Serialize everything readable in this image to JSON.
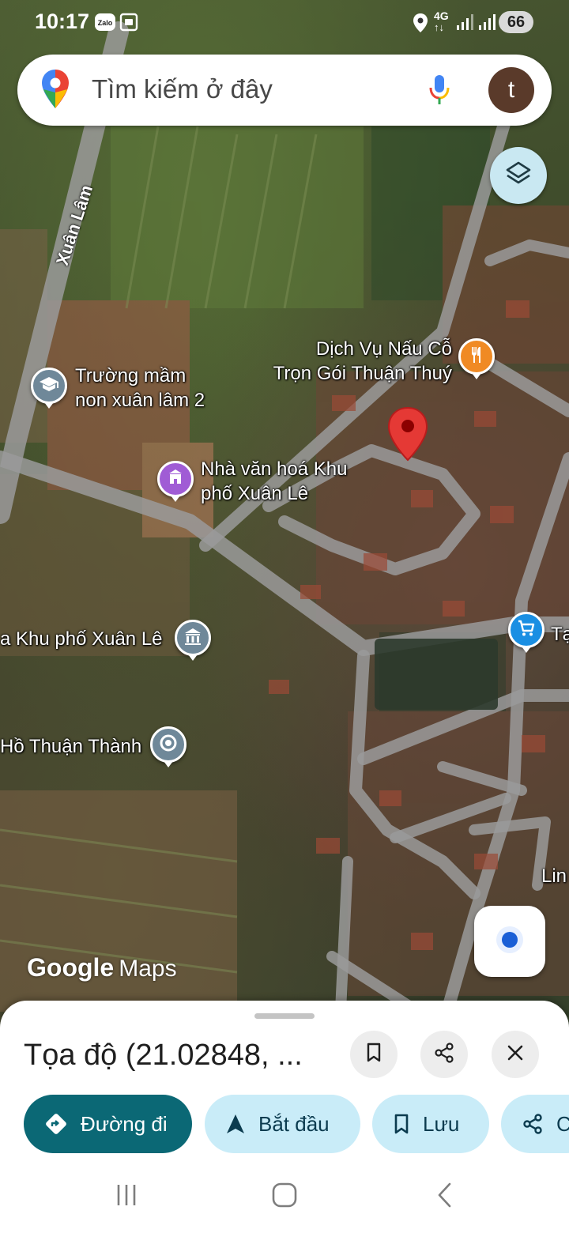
{
  "status_bar": {
    "time": "10:17",
    "app_icons": [
      "zalo-icon",
      "screenshot-icon"
    ],
    "zalo_label": "Zalo",
    "network": "4G",
    "battery": "66"
  },
  "search": {
    "placeholder": "Tìm kiếm ở đây",
    "avatar_letter": "t"
  },
  "map": {
    "street_labels": [
      "Xuân Lâm"
    ],
    "pois": [
      {
        "name": "Dịch Vụ Nấu Cỗ\nTrọn Gói Thuận Thuý",
        "icon": "restaurant-icon",
        "color": "#f08a24"
      },
      {
        "name": "Trường mầm\nnon xuân lâm 2",
        "icon": "school-icon",
        "color": "#6f8899"
      },
      {
        "name": "Nhà văn hoá Khu\nphố Xuân Lê",
        "icon": "culture-center-icon",
        "color": "#a05cd5"
      },
      {
        "name": "a Khu phố Xuân Lê",
        "icon": "temple-icon",
        "color": "#6f8899"
      },
      {
        "name": "Hồ Thuận Thành",
        "icon": "location-dot-icon",
        "color": "#6f8899"
      },
      {
        "name": "Tạ",
        "icon": "shopping-cart-icon",
        "color": "#1a8fe3"
      },
      {
        "name": "Lin",
        "icon": "",
        "color": ""
      }
    ],
    "dropped_pin_color": "#e53935",
    "watermark": {
      "google": "Google",
      "maps": "Maps"
    }
  },
  "place_sheet": {
    "title": "Tọa độ (21.02848, ...",
    "actions": {
      "save_icon": "bookmark-icon",
      "share_icon": "share-icon",
      "close_icon": "close-icon"
    },
    "chips": [
      {
        "label": "Đường đi",
        "icon": "directions-icon"
      },
      {
        "label": "Bắt đầu",
        "icon": "navigation-arrow-icon"
      },
      {
        "label": "Lưu",
        "icon": "bookmark-icon"
      },
      {
        "label": "C",
        "icon": "share-icon"
      }
    ]
  },
  "nav_bar": {
    "buttons": [
      "recent-apps-icon",
      "home-icon",
      "back-icon"
    ]
  },
  "colors": {
    "accent": "#0b6875",
    "chip_bg": "#c9ecf8",
    "road": "#9a9a9a"
  }
}
